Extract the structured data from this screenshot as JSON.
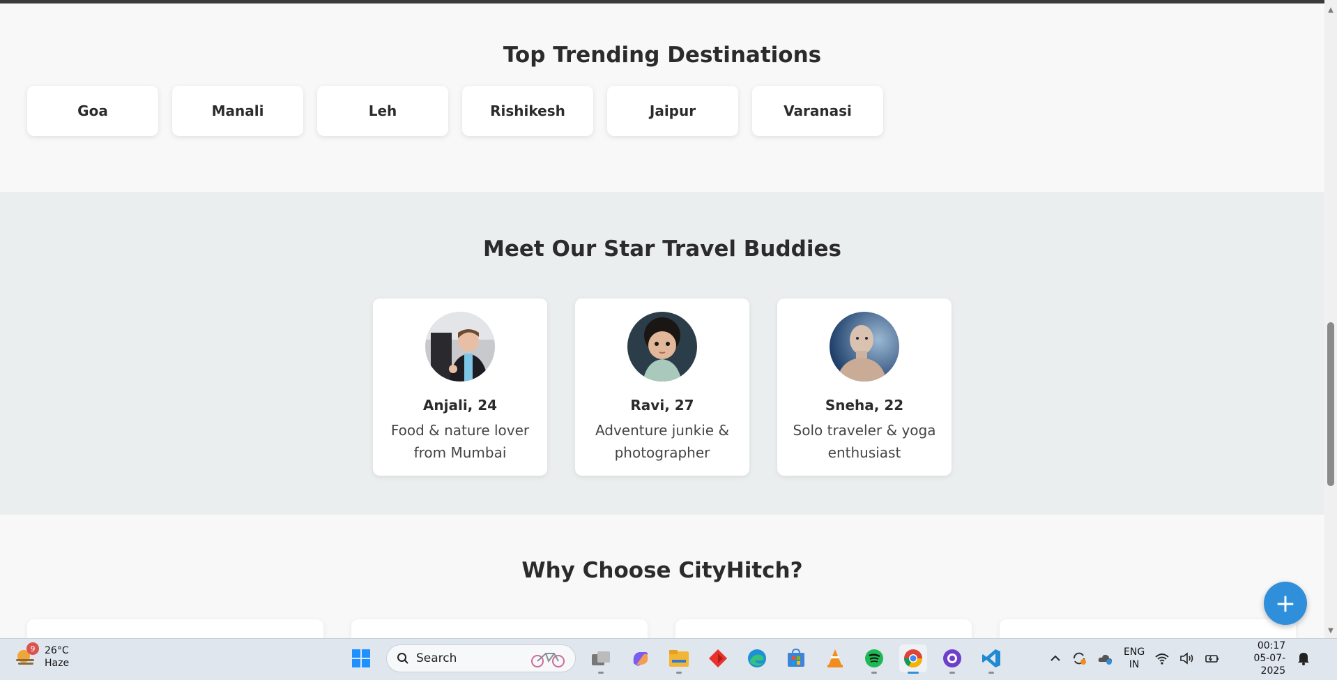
{
  "trending": {
    "title": "Top Trending Destinations",
    "destinations": [
      "Goa",
      "Manali",
      "Leh",
      "Rishikesh",
      "Jaipur",
      "Varanasi"
    ]
  },
  "buddies": {
    "title": "Meet Our Star Travel Buddies",
    "items": [
      {
        "name": "Anjali, 24",
        "desc": "Food & nature lover from Mumbai"
      },
      {
        "name": "Ravi, 27",
        "desc": "Adventure junkie & photographer"
      },
      {
        "name": "Sneha, 22",
        "desc": "Solo traveler & yoga enthusiast"
      }
    ]
  },
  "why": {
    "title": "Why Choose CityHitch?"
  },
  "fab": {
    "label": "+"
  },
  "taskbar": {
    "weather": {
      "badge": "9",
      "temp": "26°C",
      "condition": "Haze"
    },
    "search_label": "Search",
    "lang": {
      "line1": "ENG",
      "line2": "IN"
    },
    "clock": {
      "time": "00:17",
      "date": "05-07-2025"
    }
  },
  "colors": {
    "accent": "#2f8fdb",
    "page_bg": "#f8f8f8",
    "buddies_bg": "#ebeeef",
    "text": "#2b2b2b"
  },
  "icons": [
    "weather-icon",
    "windows-start-icon",
    "search-icon",
    "bicycle-icon",
    "task-view-icon",
    "copilot-icon",
    "file-explorer-icon",
    "app-red-diamond-icon",
    "edge-icon",
    "microsoft-store-icon",
    "vlc-icon",
    "spotify-icon",
    "chrome-icon",
    "github-desktop-icon",
    "vscode-icon",
    "chevron-up-icon",
    "sync-icon",
    "onedrive-icon",
    "wifi-icon",
    "volume-icon",
    "battery-icon",
    "notification-icon",
    "plus-icon"
  ]
}
